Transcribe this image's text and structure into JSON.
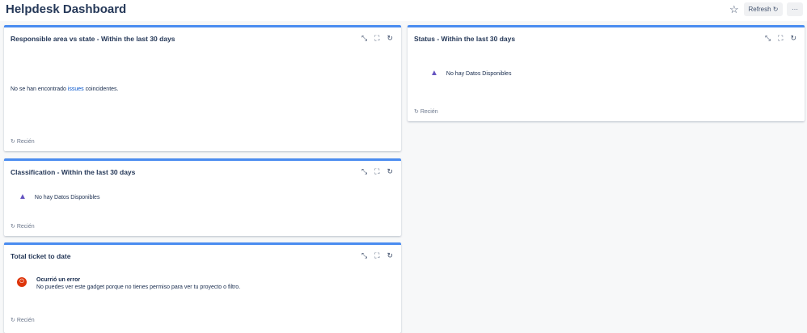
{
  "header": {
    "title": "Helpdesk Dashboard",
    "refresh_label": "Refresh",
    "more_label": "···"
  },
  "gadgets": [
    {
      "title": "Responsible area vs state - Within the last 30 days",
      "message_pre": "No se han encontrado ",
      "message_link": "issues",
      "message_post": " coincidentes.",
      "footer": "Recién"
    },
    {
      "title": "Classification - Within the last 30 days",
      "message": "No hay Datos Disponibles",
      "footer": "Recién"
    },
    {
      "title": "Total ticket to date",
      "error_title": "Ocurrió un error",
      "error_message": "No puedes ver este gadget porque no tienes permiso para ver tu proyecto o filtro.",
      "footer": "Recién"
    },
    {
      "title": "Status - Within the last 30 days",
      "message": "No hay Datos Disponibles",
      "footer": "Recién"
    }
  ],
  "colors": {
    "accent": "#4a8cf0",
    "warning": "#6554c0",
    "error": "#de350b"
  }
}
